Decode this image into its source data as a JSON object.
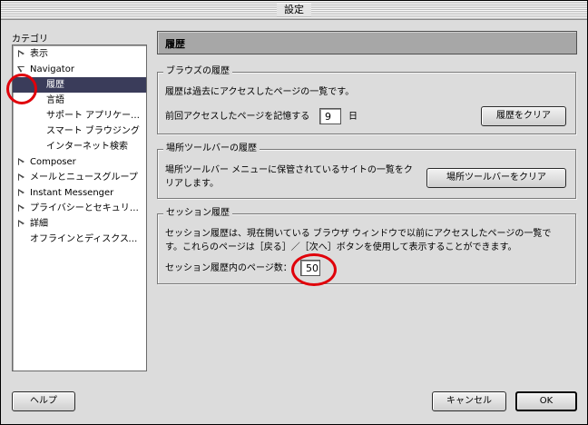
{
  "window": {
    "title": "設定"
  },
  "sidebar": {
    "label": "カテゴリ",
    "items": [
      {
        "label": "表示",
        "expander": "collapsed",
        "indent": 0
      },
      {
        "label": "Navigator",
        "expander": "expanded",
        "indent": 0
      },
      {
        "label": "履歴",
        "expander": "none",
        "indent": 2,
        "selected": true
      },
      {
        "label": "言語",
        "expander": "none",
        "indent": 2
      },
      {
        "label": "サポート アプリケーションズ",
        "expander": "none",
        "indent": 2
      },
      {
        "label": "スマート ブラウジング",
        "expander": "none",
        "indent": 2
      },
      {
        "label": "インターネット検索",
        "expander": "none",
        "indent": 2
      },
      {
        "label": "Composer",
        "expander": "collapsed",
        "indent": 0
      },
      {
        "label": "メールとニュースグループ",
        "expander": "collapsed",
        "indent": 0
      },
      {
        "label": "Instant Messenger",
        "expander": "collapsed",
        "indent": 0
      },
      {
        "label": "プライバシーとセキュリティ",
        "expander": "collapsed",
        "indent": 0
      },
      {
        "label": "詳細",
        "expander": "collapsed",
        "indent": 0
      },
      {
        "label": "オフラインとディスクスペース",
        "expander": "none",
        "indent": 1
      }
    ]
  },
  "panel": {
    "title": "履歴",
    "browser_history": {
      "legend": "ブラウズの履歴",
      "description": "履歴は過去にアクセスしたページの一覧です。",
      "remember_label": "前回アクセスしたページを記憶する",
      "remember_value": "9",
      "days_label": "日",
      "clear_button": "履歴をクリア"
    },
    "location_bar": {
      "legend": "場所ツールバーの履歴",
      "description_line1": "場所ツールバー メニューに保管されているサイトの一覧をク",
      "description_line2": "リアします。",
      "clear_button": "場所ツールバーをクリア"
    },
    "session_history": {
      "legend": "セッション履歴",
      "description_line1": "セッション履歴は、現在開いている ブラウザ ウィンドウで以前にアクセスしたページの一覧で",
      "description_line2": "す。これらのページは［戻る］／［次へ］ボタンを使用して表示することができます。",
      "pages_label": "セッション履歴内のページ数：",
      "pages_value": "50"
    }
  },
  "footer": {
    "help_button": "ヘルプ",
    "cancel_button": "キャンセル",
    "ok_button": "OK"
  },
  "colors": {
    "annotation": "#e0000a",
    "selection": "#3a3c5a"
  }
}
